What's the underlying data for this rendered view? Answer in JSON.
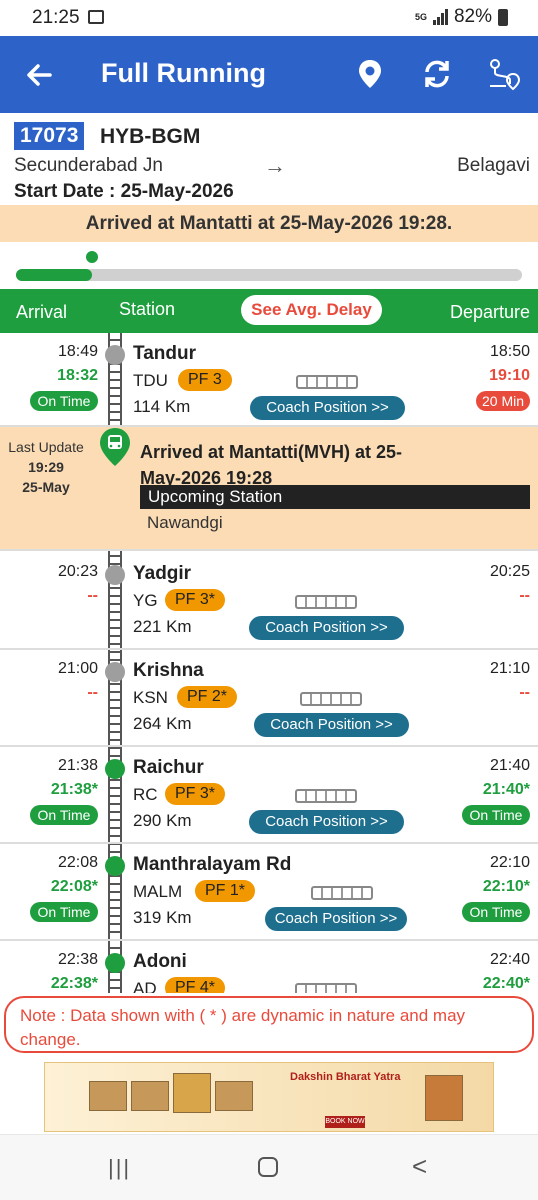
{
  "status_bar": {
    "time": "21:25",
    "network": "5G",
    "battery": "82%"
  },
  "app_bar": {
    "title": "Full Running",
    "back_icon": "arrow-left-icon",
    "icons": [
      "location-pin-icon",
      "refresh-icon",
      "route-map-icon"
    ]
  },
  "train": {
    "number": "17073",
    "name": "HYB-BGM",
    "from": "Secunderabad Jn",
    "arrow": "→",
    "to": "Belagavi",
    "start_date": "Start Date : 25-May-2026"
  },
  "arrived_banner": "Arrived at Mantatti at 25-May-2026 19:28.",
  "progress_fraction": 0.15,
  "table_header": {
    "arrival": "Arrival",
    "station": "Station",
    "avg_delay_button": "See Avg. Delay",
    "departure": "Departure"
  },
  "current": {
    "last_update_label": "Last Update",
    "last_update_time": "19:29",
    "last_update_date": "25-May",
    "message": "Arrived at Mantatti(MVH) at 25-May-2026 19:28",
    "upcoming_label": "Upcoming Station",
    "upcoming_station": "Nawandgi"
  },
  "coach_button_label": "Coach Position >>",
  "stations": [
    {
      "name": "Tandur",
      "code": "TDU",
      "pf": "PF 3",
      "km": "114 Km",
      "sched_arr": "18:49",
      "act_arr": "18:32",
      "sched_dep": "18:50",
      "act_dep": "19:10",
      "arr_badge": "On Time",
      "dep_badge": "20 Min",
      "dot": "grey"
    },
    {
      "name": "Yadgir",
      "code": "YG",
      "pf": "PF 3*",
      "km": "221 Km",
      "sched_arr": "20:23",
      "act_arr": "--",
      "sched_dep": "20:25",
      "act_dep": "--",
      "arr_badge": "",
      "dep_badge": "",
      "dot": "grey"
    },
    {
      "name": "Krishna",
      "code": "KSN",
      "pf": "PF 2*",
      "km": "264 Km",
      "sched_arr": "21:00",
      "act_arr": "--",
      "sched_dep": "21:10",
      "act_dep": "--",
      "arr_badge": "",
      "dep_badge": "",
      "dot": "grey"
    },
    {
      "name": "Raichur",
      "code": "RC",
      "pf": "PF 3*",
      "km": "290 Km",
      "sched_arr": "21:38",
      "act_arr": "21:38*",
      "sched_dep": "21:40",
      "act_dep": "21:40*",
      "arr_badge": "On Time",
      "dep_badge": "On Time",
      "dot": "green"
    },
    {
      "name": "Manthralayam Rd",
      "code": "MALM",
      "pf": "PF 1*",
      "km": "319 Km",
      "sched_arr": "22:08",
      "act_arr": "22:08*",
      "sched_dep": "22:10",
      "act_dep": "22:10*",
      "arr_badge": "On Time",
      "dep_badge": "On Time",
      "dot": "green"
    },
    {
      "name": "Adoni",
      "code": "AD",
      "pf": "PF 4*",
      "km": "",
      "sched_arr": "22:38",
      "act_arr": "22:38*",
      "sched_dep": "22:40",
      "act_dep": "22:40*",
      "arr_badge": "",
      "dep_badge": "",
      "dot": "green"
    }
  ],
  "note": "Note : Data shown with ( * ) are dynamic in nature and may change.",
  "ad": {
    "title": "Dakshin Bharat Yatra",
    "button": "BOOK NOW"
  },
  "nav": {
    "recent": "|||",
    "home": "home-icon",
    "back": "<"
  },
  "colors": {
    "primary_blue": "#2d63c8",
    "green": "#1e9e3e",
    "red": "#e84b3c",
    "orange": "#f19700",
    "banner": "#fbdcb4"
  }
}
